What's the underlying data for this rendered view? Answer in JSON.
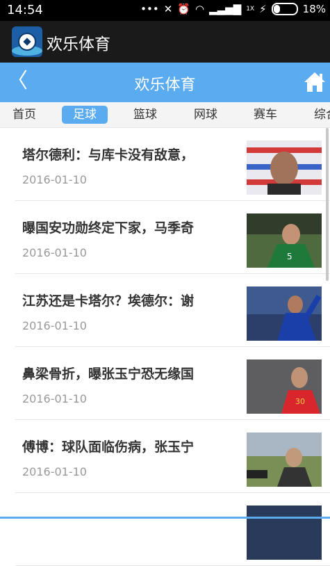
{
  "status": {
    "time": "14:54",
    "network": "1X",
    "battery": "18%"
  },
  "app": {
    "title": "欢乐体育"
  },
  "header": {
    "title": "欢乐体育"
  },
  "tabs": [
    {
      "label": "首页"
    },
    {
      "label": "足球",
      "active": true
    },
    {
      "label": "篮球"
    },
    {
      "label": "网球"
    },
    {
      "label": "赛车"
    },
    {
      "label": "综合"
    }
  ],
  "articles": [
    {
      "headline": "塔尔德利：与库卡没有敌意，",
      "date": "2016-01-10"
    },
    {
      "headline": "曝国安功勋终定下家，马季奇",
      "date": "2016-01-10"
    },
    {
      "headline": "江苏还是卡塔尔？埃德尔：谢",
      "date": "2016-01-10"
    },
    {
      "headline": "鼻梁骨折，曝张玉宁恐无缘国",
      "date": "2016-01-10"
    },
    {
      "headline": "傅博：球队面临伤病，张玉宁",
      "date": "2016-01-10"
    },
    {
      "headline": "",
      "date": ""
    }
  ],
  "colors": {
    "accent": "#5aabf0",
    "appbar": "#1a1a1a"
  }
}
